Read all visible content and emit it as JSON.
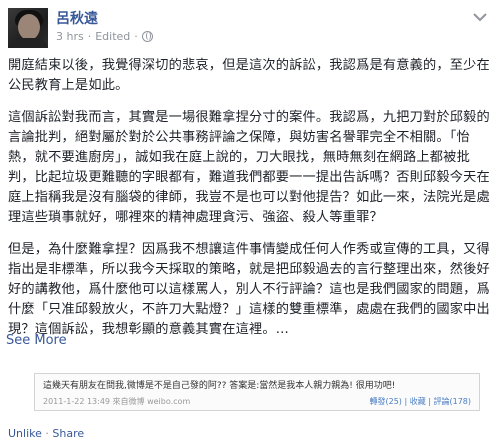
{
  "author": {
    "name": "呂秋遠"
  },
  "meta": {
    "time": "3 hrs",
    "separator": "·",
    "edited": "Edited",
    "visibility_icon": "globe-icon"
  },
  "post": {
    "paragraphs": [
      "開庭結束以後，我覺得深切的悲哀，但是這次的訴訟，我認爲是有意義的，至少在公民教育上是如此。",
      "這個訴訟對我而言，其實是一場很難拿捏分寸的案件。我認爲，九把刀對於邱毅的言論批判，絕對屬於對於公共事務評論之保障，與妨害名譽罪完全不相關。「怡熱，就不要進廚房」，誠如我在庭上說的，刀大眼找，無時無刻在網路上都被批判，比起垃圾更難聽的字眼都有，難道我們都要一一提出告訴嗎？否則邱毅今天在庭上指稱我是沒有腦袋的律師，我豈不是也可以對他提告？如此一來，法院光是處理這些瑣事就好，哪裡來的精神處理貪污、強盜、殺人等重罪？",
      "但是，為什麼難拿捏？因爲我不想讓這件事情變成任何人作秀或宣傳的工具，又得指出是非標準，所以我今天採取的策略，就是把邱毅過去的言行整理出來，然後好好的講教他，爲什麼他可以這樣罵人，別人不行評論？這也是我們國家的問題，爲什麼「只准邱毅放火，不許刀大點燈？」這樣的雙重標準，處處在我們的國家中出現？這個訴訟，我想彰顯的意義其實在這裡。..."
    ],
    "see_more": "See More"
  },
  "shared": {
    "line1": "這幾天有朋友在問我,微博是不是自己發的阿?? 答案是:當然是我本人親力親為! 很用功吧!",
    "line2": "2011-1-22 13:49  來自微博 weibo.com",
    "line3": "轉發(25) | 收藏 | 評論(178)"
  },
  "actions": {
    "unlike": "Unlike",
    "separator": "·",
    "share": "Share"
  }
}
